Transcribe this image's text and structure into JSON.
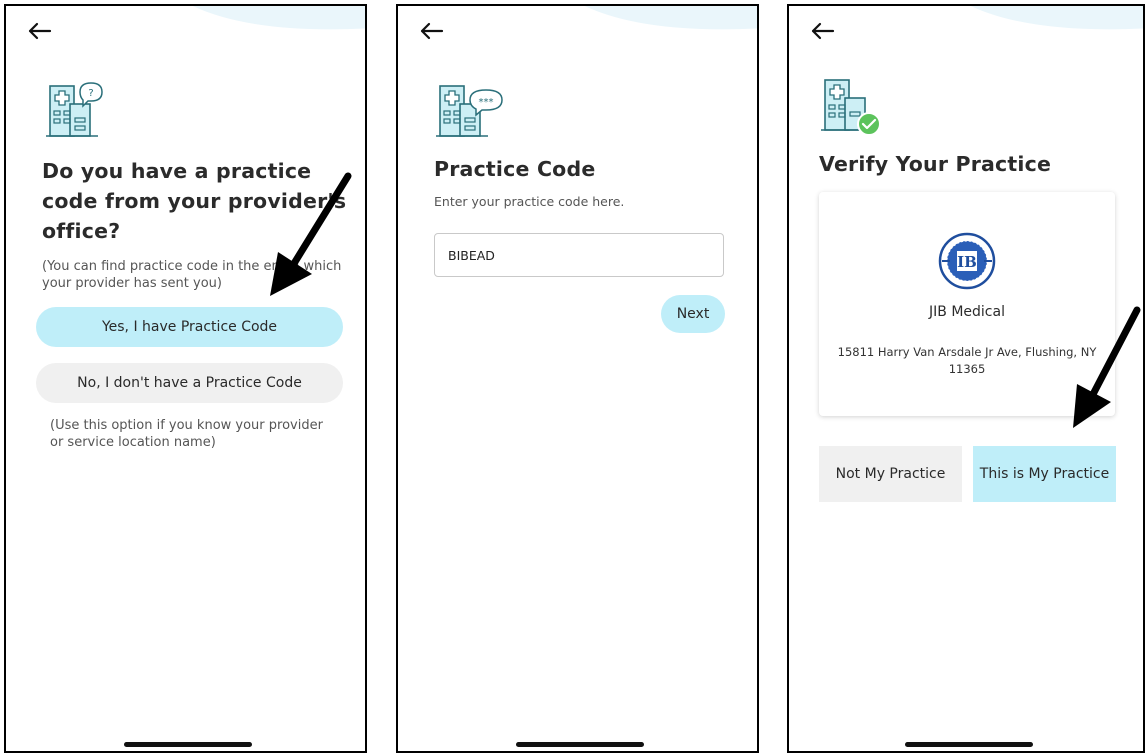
{
  "screen1": {
    "title": "Do you have a practice code from your provider's office?",
    "hint": "(You can find practice code in the email which your provider has sent you)",
    "yes_label": "Yes, I have Practice Code",
    "no_label": "No, I don't have a Practice Code",
    "note": "(Use this option if you know your provider or service location name)"
  },
  "screen2": {
    "title": "Practice Code",
    "subtitle": "Enter your practice code here.",
    "code_value": "BIBEAD",
    "next_label": "Next"
  },
  "screen3": {
    "title": "Verify Your Practice",
    "practice_name": "JIB Medical",
    "address": "15811 Harry Van Arsdale Jr Ave, Flushing, NY 11365",
    "not_label": "Not My Practice",
    "yes_label": "This is My Practice"
  },
  "colors": {
    "accent_blue": "#bfeef9",
    "secondary_grey": "#f0f0f0",
    "icon_teal": "#5bbccb",
    "check_green": "#5cc35c"
  }
}
